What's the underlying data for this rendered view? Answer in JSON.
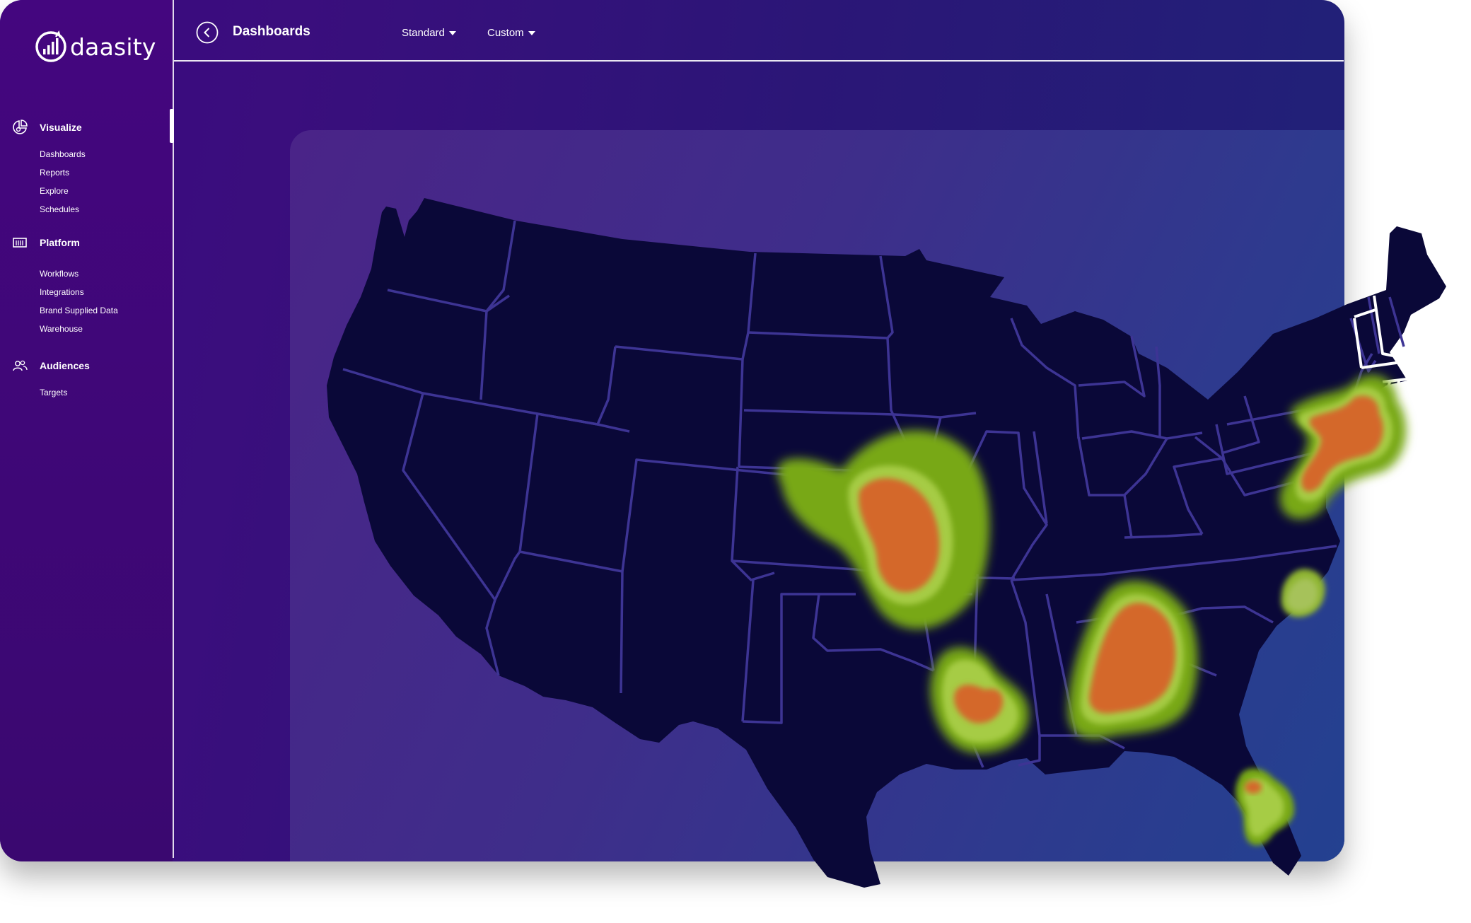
{
  "app": {
    "logo_text": "daasity",
    "page_title": "Dashboards",
    "filters": [
      {
        "label": "Standard"
      },
      {
        "label": "Custom"
      }
    ]
  },
  "sidebar": {
    "sections": [
      {
        "label": "Visualize",
        "icon": "pie-chart-icon",
        "items": [
          "Dashboards",
          "Reports",
          "Explore",
          "Schedules"
        ]
      },
      {
        "label": "Platform",
        "icon": "warehouse-icon",
        "items": [
          "Workflows",
          "Integrations",
          "Brand Supplied Data",
          "Warehouse"
        ]
      },
      {
        "label": "Audiences",
        "icon": "people-icon",
        "items": [
          "Targets"
        ]
      }
    ]
  },
  "map": {
    "type": "heatmap",
    "region": "United States",
    "colors": {
      "land": "#0a0838",
      "borders": "#3d3494",
      "low": "#78a816",
      "mid": "#a6cc44",
      "high": "#d4682c"
    },
    "hotspots": [
      {
        "area": "Kansas / Missouri",
        "intensity": "high"
      },
      {
        "area": "New York / New Jersey",
        "intensity": "high"
      },
      {
        "area": "Alabama / Georgia",
        "intensity": "high"
      },
      {
        "area": "Louisiana",
        "intensity": "high"
      },
      {
        "area": "Central Florida",
        "intensity": "medium"
      },
      {
        "area": "North Carolina coast",
        "intensity": "low"
      }
    ]
  }
}
